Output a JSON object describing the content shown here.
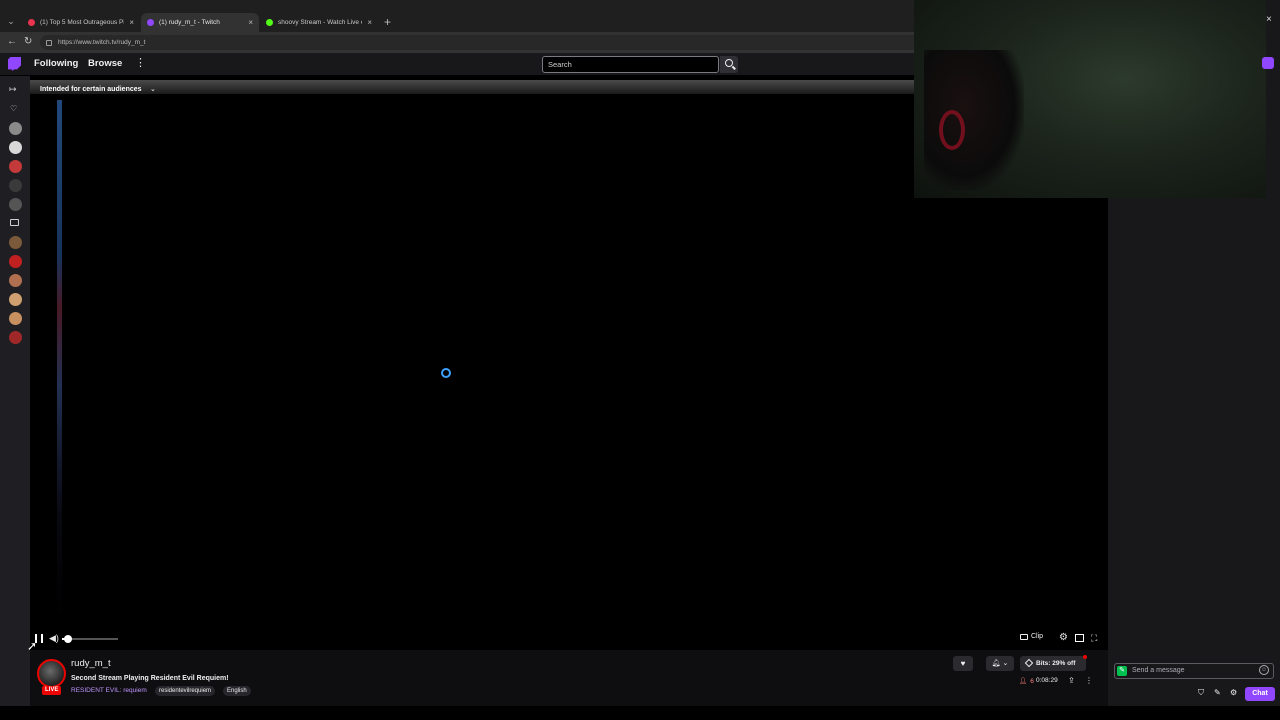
{
  "browser": {
    "tabs": [
      {
        "title": "(1) Top 5 Most Outrageous Pitche",
        "favicon_color": "#e8344e",
        "active": false
      },
      {
        "title": "(1) rudy_m_t - Twitch",
        "favicon_color": "#9147ff",
        "active": true
      },
      {
        "title": "shoovy Stream - Watch Live on Ki",
        "favicon_color": "#53fc18",
        "active": false
      }
    ],
    "new_tab_icon": "+",
    "close_icon": "×",
    "url": "https://www.twitch.tv/rudy_m_t"
  },
  "topnav": {
    "following": "Following",
    "browse": "Browse",
    "more_icon": "⋮",
    "search_placeholder": "Search"
  },
  "player": {
    "audience_label": "Intended for certain audiences",
    "audience_chevron": "⌄",
    "clip_label": "Clip",
    "volume_fraction": 0.1
  },
  "channel": {
    "name": "rudy_m_t",
    "live_badge": "LIVE",
    "title": "Second Stream Playing Resident Evil Requiem!",
    "game": "RESIDENT EVIL: requiem",
    "tags": [
      "residentevilrequiem",
      "English"
    ],
    "bits_label": "Bits: 29% off",
    "viewers": "6",
    "uptime": "0:08:29"
  },
  "chat": {
    "placeholder": "Send a message",
    "chat_button": "Chat"
  },
  "colors": {
    "twitch_purple": "#9147ff",
    "live_red": "#eb0400",
    "link_purple": "#bf94ff"
  }
}
